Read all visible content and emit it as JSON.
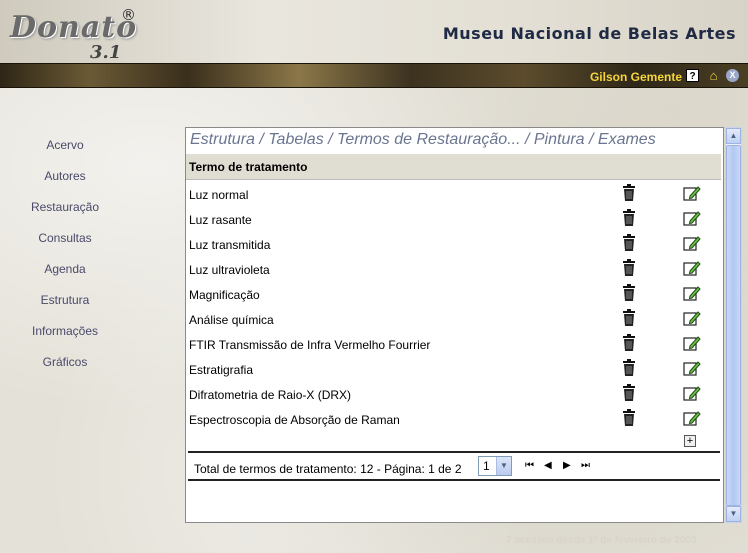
{
  "header": {
    "logo_word": "Donato",
    "logo_reg": "®",
    "logo_version": "3.1",
    "museum_title": "Museu Nacional de Belas Artes",
    "user_name": "Gilson Gemente",
    "help_glyph": "?",
    "home_glyph": "⌂",
    "exit_glyph": "X"
  },
  "sidebar": {
    "items": [
      {
        "label": "Acervo"
      },
      {
        "label": "Autores"
      },
      {
        "label": "Restauração"
      },
      {
        "label": "Consultas"
      },
      {
        "label": "Agenda"
      },
      {
        "label": "Estrutura"
      },
      {
        "label": "Informações"
      },
      {
        "label": "Gráficos"
      }
    ]
  },
  "main": {
    "breadcrumb": "Estrutura / Tabelas / Termos de Restauração... / Pintura / Exames",
    "column_header": "Termo de tratamento",
    "rows": [
      {
        "label": "Luz normal"
      },
      {
        "label": "Luz rasante"
      },
      {
        "label": "Luz transmitida"
      },
      {
        "label": "Luz ultravioleta"
      },
      {
        "label": "Magnificação"
      },
      {
        "label": "Análise química"
      },
      {
        "label": "FTIR Transmissão de Infra Vermelho Fourrier"
      },
      {
        "label": "Estratigrafia"
      },
      {
        "label": "Difratometria de Raio-X (DRX)"
      },
      {
        "label": "Espectroscopia de Absorção de Raman"
      }
    ],
    "add_glyph": "+",
    "footer_text": "Total de termos de tratamento: 12 - Página: 1 de 2",
    "page_select_value": "1",
    "nav": {
      "first": "⏮",
      "prev": "◀",
      "next": "▶",
      "last": "⏭"
    }
  },
  "access_info": "7 acessos desde 1º de fevereiro de 2003",
  "colors": {
    "accent_yellow": "#f5d53a",
    "title_navy": "#1f2a44",
    "breadcrumb": "#6a7590"
  },
  "icons": {
    "delete": "trash-icon",
    "edit": "edit-icon",
    "add": "add-icon"
  }
}
